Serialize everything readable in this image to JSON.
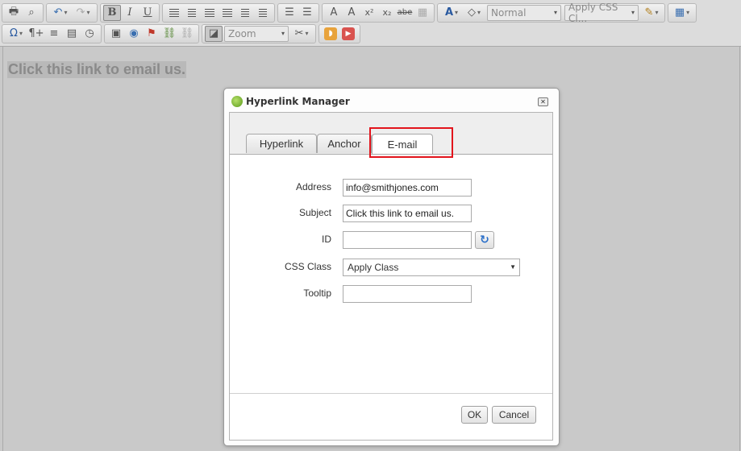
{
  "toolbar": {
    "row1": [
      {
        "icon": "print-icon",
        "glyph": "🖶"
      },
      {
        "icon": "find-replace-icon",
        "glyph": "⌕"
      },
      {
        "icon": "undo-icon",
        "glyph": "↶"
      },
      {
        "icon": "redo-icon",
        "glyph": "↷"
      },
      {
        "icon": "bold-icon",
        "glyph": "B"
      },
      {
        "icon": "italic-icon",
        "glyph": "I"
      },
      {
        "icon": "underline-icon",
        "glyph": "U"
      },
      {
        "icon": "align-left-icon"
      },
      {
        "icon": "align-center-icon"
      },
      {
        "icon": "align-right-icon"
      },
      {
        "icon": "justify-icon"
      },
      {
        "icon": "outdent-icon"
      },
      {
        "icon": "indent-icon"
      },
      {
        "icon": "numbered-list-icon",
        "glyph": "☰"
      },
      {
        "icon": "bullet-list-icon",
        "glyph": "☰"
      },
      {
        "icon": "format-painter-icon",
        "glyph": "A"
      },
      {
        "icon": "strip-format-icon",
        "glyph": "A"
      },
      {
        "icon": "superscript-icon",
        "glyph": "x²"
      },
      {
        "icon": "subscript-icon",
        "glyph": "x₂"
      },
      {
        "icon": "strikethrough-icon",
        "glyph": "abe"
      },
      {
        "icon": "insert-image-icon",
        "glyph": "▦"
      },
      {
        "icon": "fore-color-icon",
        "glyph": "A"
      },
      {
        "icon": "back-color-icon",
        "glyph": "◇"
      }
    ],
    "paragraph_style": "Normal",
    "css_class": "Apply CSS Cl...",
    "format_stripper_glyph": "✎",
    "table_glyph": "▦",
    "row2": [
      {
        "icon": "special-characters-icon",
        "glyph": "Ω"
      },
      {
        "icon": "paragraph-icon",
        "glyph": "¶+"
      },
      {
        "icon": "horizontal-rule-icon",
        "glyph": "≡"
      },
      {
        "icon": "templates-icon",
        "glyph": "▤"
      },
      {
        "icon": "clock-icon",
        "glyph": "◷"
      },
      {
        "icon": "image-manager-icon",
        "glyph": "▣"
      },
      {
        "icon": "media-icon",
        "glyph": "◉"
      },
      {
        "icon": "flash-icon",
        "glyph": "⚑"
      },
      {
        "icon": "hyperlink-icon",
        "glyph": "⛓"
      },
      {
        "icon": "remove-link-icon",
        "glyph": "⛓"
      },
      {
        "icon": "zoom-toggle-icon",
        "glyph": "◪"
      },
      {
        "icon": "module-manager-icon",
        "glyph": "✂"
      },
      {
        "icon": "rss-icon",
        "glyph": "◗"
      },
      {
        "icon": "youtube-icon",
        "glyph": "▶"
      }
    ],
    "zoom_label": "Zoom"
  },
  "editor": {
    "content_text": "Click this link to email us."
  },
  "dialog": {
    "title": "Hyperlink Manager",
    "close_glyph": "✕",
    "tabs": [
      {
        "label": "Hyperlink"
      },
      {
        "label": "Anchor"
      },
      {
        "label": "E-mail"
      }
    ],
    "active_tab": "E-mail",
    "fields": {
      "address": {
        "label": "Address",
        "value": "info@smithjones.com"
      },
      "subject": {
        "label": "Subject",
        "value": "Click this link to email us."
      },
      "id": {
        "label": "ID",
        "value": ""
      },
      "css_class": {
        "label": "CSS Class",
        "value": "Apply Class"
      },
      "tooltip": {
        "label": "Tooltip",
        "value": ""
      }
    },
    "refresh_glyph": "↻",
    "ok_label": "OK",
    "cancel_label": "Cancel"
  },
  "colors": {
    "highlight": "#e2141c",
    "refresh_blue": "#2a6fc9",
    "logo_green": "#5a9a1a"
  }
}
